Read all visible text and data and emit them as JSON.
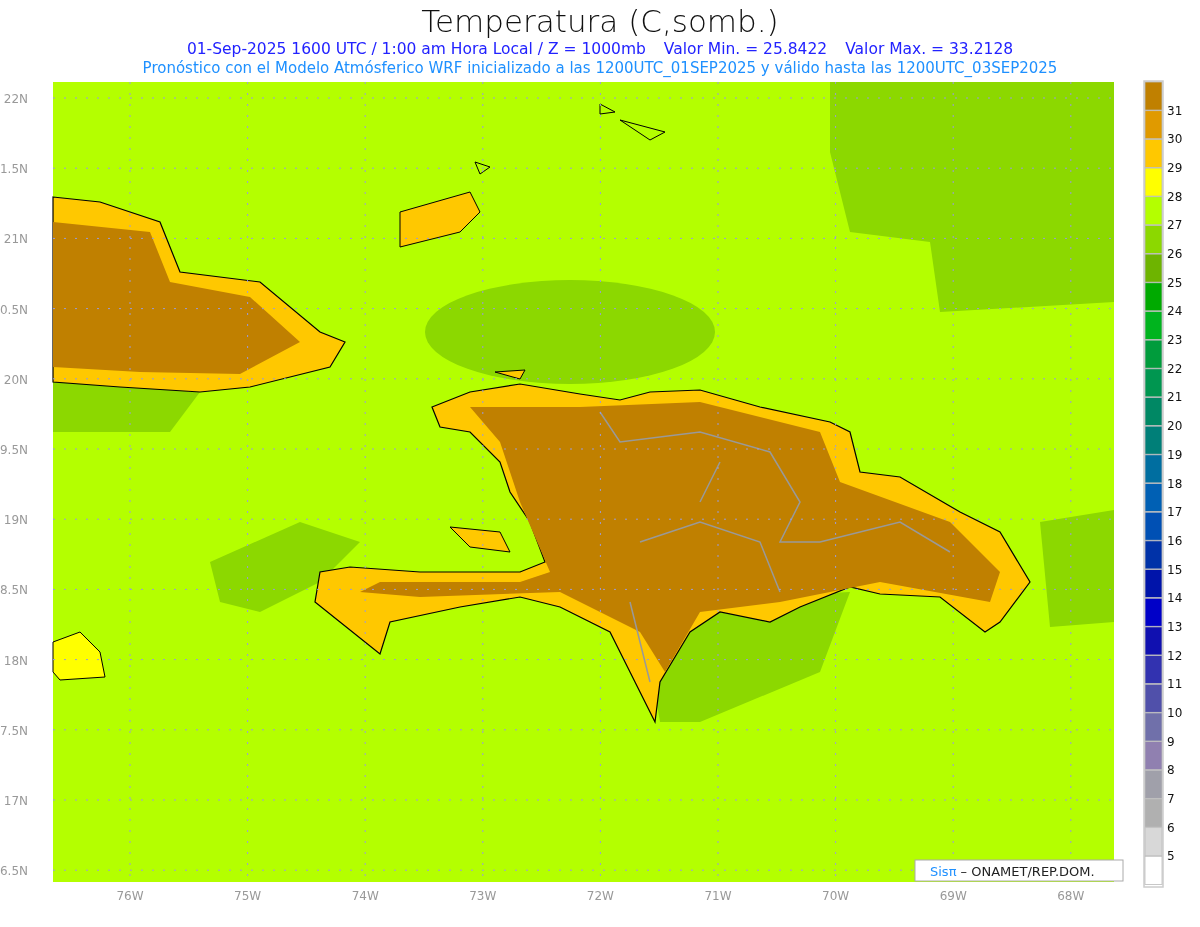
{
  "title": "Temperatura (C,somb.)",
  "valid_time": "01-Sep-2025  1600 UTC / 1:00 am Hora Local / Z = 1000mb",
  "min": "Valor Min. = 25.8422",
  "max": "Valor Max. = 33.2128",
  "description": "Pronóstico con el Modelo Atmósferico WRF inicializado a las 1200UTC_01SEP2025 y válido hasta las  1200UTC_03SEP2025",
  "y_axis": [
    "22N",
    "1.5N",
    "21N",
    "0.5N",
    "20N",
    "9.5N",
    "19N",
    "8.5N",
    "18N",
    "7.5N",
    "17N",
    "6.5N"
  ],
  "x_axis": [
    "76W",
    "75W",
    "74W",
    "73W",
    "72W",
    "71W",
    "70W",
    "69W",
    "68W"
  ],
  "credit": {
    "brand": "Sisπ",
    "text": "– ONAMET/REP.DOM."
  },
  "colors": [
    {
      "color": "#c08000",
      "label": "31"
    },
    {
      "color": "#e09a00",
      "label": "30"
    },
    {
      "color": "#ffc800",
      "label": "29"
    },
    {
      "color": "#ffff00",
      "label": "28"
    },
    {
      "color": "#b4ff00",
      "label": "27"
    },
    {
      "color": "#8cd800",
      "label": "26"
    },
    {
      "color": "#6eb400",
      "label": "25"
    },
    {
      "color": "#00aa00",
      "label": "24"
    },
    {
      "color": "#00b41e",
      "label": "23"
    },
    {
      "color": "#009c3c",
      "label": "22"
    },
    {
      "color": "#009650",
      "label": "21"
    },
    {
      "color": "#008864",
      "label": "20"
    },
    {
      "color": "#007f78",
      "label": "19"
    },
    {
      "color": "#006ea0",
      "label": "18"
    },
    {
      "color": "#0060b4",
      "label": "17"
    },
    {
      "color": "#0050b4",
      "label": "16"
    },
    {
      "color": "#0032a8",
      "label": "15"
    },
    {
      "color": "#0014aa",
      "label": "14"
    },
    {
      "color": "#0000c8",
      "label": "13"
    },
    {
      "color": "#1010b0",
      "label": "12"
    },
    {
      "color": "#3232b0",
      "label": "11"
    },
    {
      "color": "#5050aa",
      "label": "10"
    },
    {
      "color": "#7070aa",
      "label": "9"
    },
    {
      "color": "#9080b0",
      "label": "8"
    },
    {
      "color": "#a0a0aa",
      "label": "7"
    },
    {
      "color": "#b0b0b0",
      "label": "6"
    },
    {
      "color": "#d8d8d8",
      "label": "5"
    },
    {
      "color": "#ffffff"
    }
  ]
}
